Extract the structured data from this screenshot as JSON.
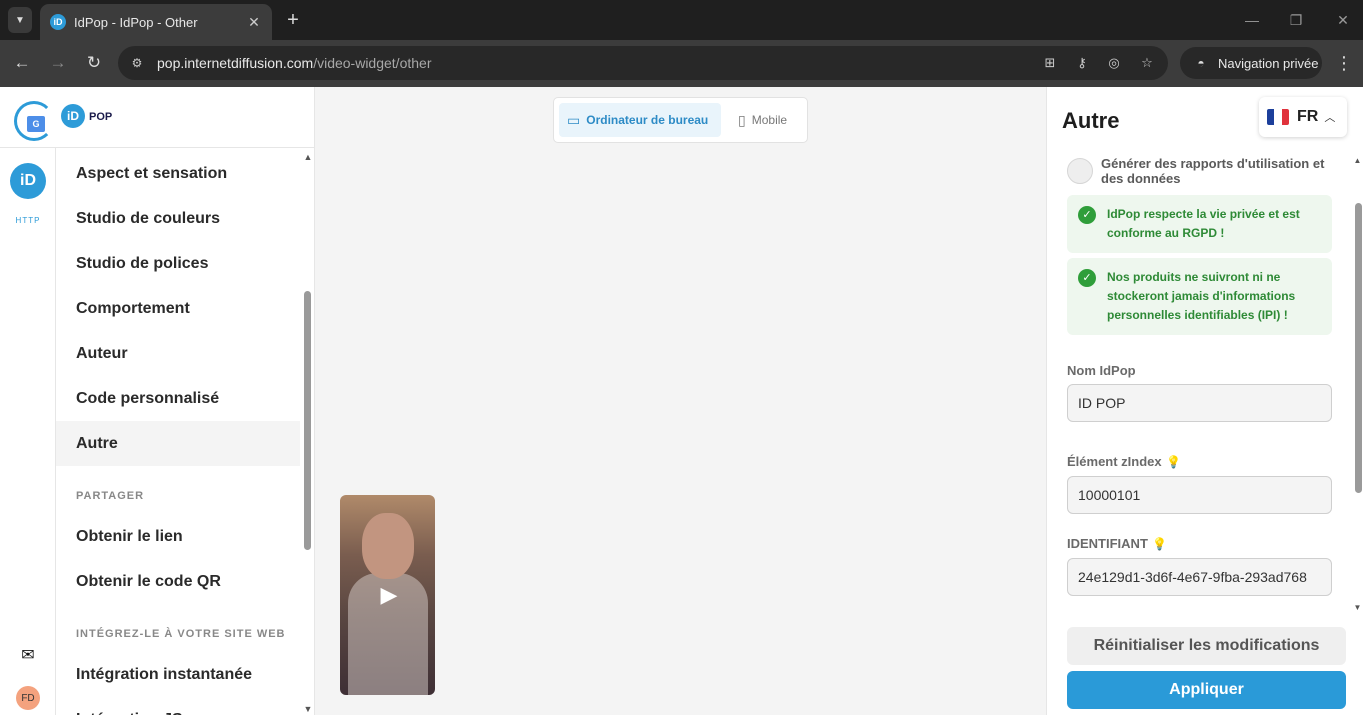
{
  "browser": {
    "tab_title": "IdPop - IdPop - Other",
    "url_host": "pop.internetdiffusion.com",
    "url_path": "/video-widget/other",
    "incognito_label": "Navigation privée"
  },
  "brand": {
    "name": "POP",
    "logo_letter": "iD",
    "translate_letter": "G"
  },
  "rail": {
    "small_text": "HTTP",
    "avatar_initials": "FD"
  },
  "sidebar": {
    "items": [
      {
        "label": "Aspect et sensation"
      },
      {
        "label": "Studio de couleurs"
      },
      {
        "label": "Studio de polices"
      },
      {
        "label": "Comportement"
      },
      {
        "label": "Auteur"
      },
      {
        "label": "Code personnalisé"
      },
      {
        "label": "Autre",
        "active": true
      }
    ],
    "share_section": "PARTAGER",
    "share_items": [
      {
        "label": "Obtenir le lien"
      },
      {
        "label": "Obtenir le code QR"
      }
    ],
    "embed_section": "INTÉGREZ-LE À VOTRE SITE WEB",
    "embed_items": [
      {
        "label": "Intégration instantanée"
      },
      {
        "label": "Intégration JS"
      }
    ]
  },
  "preview": {
    "desktop_label": "Ordinateur de bureau",
    "mobile_label": "Mobile"
  },
  "panel": {
    "title": "Autre",
    "language_code": "FR",
    "toggle_label": "Générer des rapports d'utilisation et des données",
    "notice_1": "IdPop respecte la vie privée et est conforme au RGPD !",
    "notice_2": "Nos produits ne suivront ni ne stockeront jamais d'informations personnelles identifiables (IPI) !",
    "name_label": "Nom IdPop",
    "name_value": "ID POP",
    "zindex_label": "Élément zIndex",
    "zindex_value": "10000101",
    "id_label": "IDENTIFIANT",
    "id_value": "24e129d1-3d6f-4e67-9fba-293ad768",
    "reset_label": "Réinitialiser les modifications",
    "apply_label": "Appliquer"
  },
  "colors": {
    "accent": "#2a9ad8",
    "success": "#2f9e3a",
    "chrome_dark": "#1f1f1f"
  }
}
